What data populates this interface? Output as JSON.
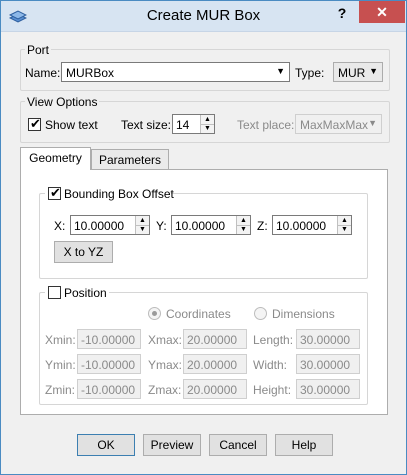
{
  "window": {
    "title": "Create MUR Box",
    "help": "?",
    "close": "✕"
  },
  "port": {
    "group_title": "Port",
    "name_label": "Name:",
    "name_value": "MURBox",
    "type_label": "Type:",
    "type_value": "MUR"
  },
  "view_options": {
    "group_title": "View Options",
    "show_text_label": "Show text",
    "show_text_checked": true,
    "text_size_label": "Text size:",
    "text_size_value": "14",
    "text_place_label": "Text place:",
    "text_place_value": "MaxMaxMax"
  },
  "tabs": [
    {
      "label": "Geometry",
      "active": true
    },
    {
      "label": "Parameters",
      "active": false
    }
  ],
  "bounding_box": {
    "label": "Bounding Box Offset",
    "checked": true,
    "x_label": "X:",
    "x_value": "10.00000",
    "y_label": "Y:",
    "y_value": "10.00000",
    "z_label": "Z:",
    "z_value": "10.00000",
    "x_to_yz": "X to YZ"
  },
  "position": {
    "label": "Position",
    "checked": false,
    "coordinates_label": "Coordinates",
    "dimensions_label": "Dimensions",
    "xmin_label": "Xmin:",
    "xmin_value": "-10.00000",
    "ymin_label": "Ymin:",
    "ymin_value": "-10.00000",
    "zmin_label": "Zmin:",
    "zmin_value": "-10.00000",
    "xmax_label": "Xmax:",
    "xmax_value": "20.00000",
    "ymax_label": "Ymax:",
    "ymax_value": "20.00000",
    "zmax_label": "Zmax:",
    "zmax_value": "20.00000",
    "length_label": "Length:",
    "length_value": "30.00000",
    "width_label": "Width:",
    "width_value": "30.00000",
    "height_label": "Height:",
    "height_value": "30.00000"
  },
  "buttons": {
    "ok": "OK",
    "preview": "Preview",
    "cancel": "Cancel",
    "help": "Help"
  },
  "icons": {
    "check": "✔",
    "arrow_down": "▼",
    "arrow_up": "▲"
  },
  "colors": {
    "close_bg": "#c75050",
    "titlebar": "#d7e4f2",
    "window_border": "#4a8bc2"
  }
}
